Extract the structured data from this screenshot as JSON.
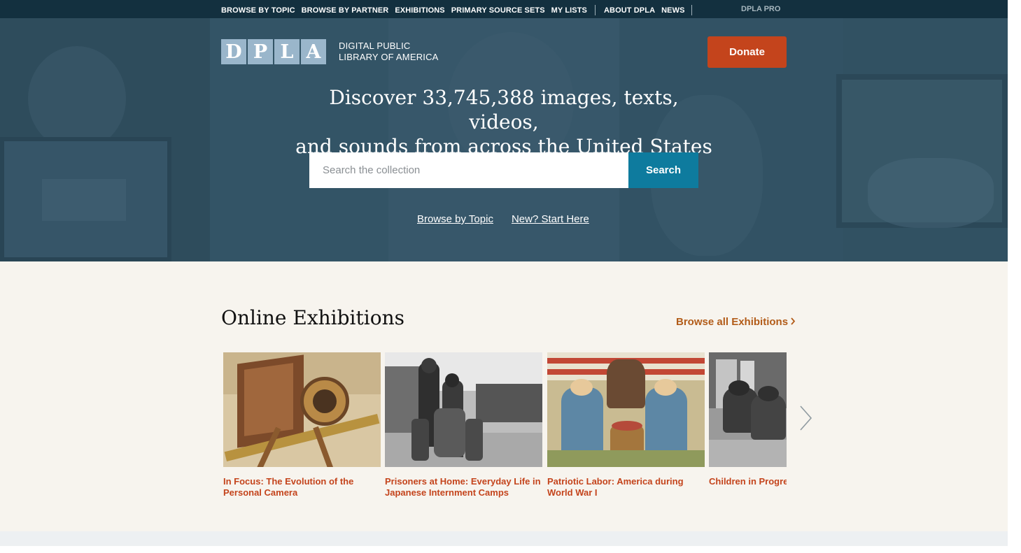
{
  "topnav": {
    "items": [
      "BROWSE BY TOPIC",
      "BROWSE BY PARTNER",
      "EXHIBITIONS",
      "PRIMARY SOURCE SETS",
      "MY LISTS"
    ],
    "about": "ABOUT DPLA",
    "news": "NEWS",
    "pro": "DPLA PRO"
  },
  "logo": {
    "letters": [
      "D",
      "P",
      "L",
      "A"
    ],
    "name": "DIGITAL PUBLIC LIBRARY OF AMERICA"
  },
  "donate_label": "Donate",
  "hero": {
    "headline_line1": "Discover 33,745,388 images, texts, videos,",
    "headline_line2": "and sounds from across the United States",
    "search_placeholder": "Search the collection",
    "search_button": "Search",
    "links": [
      "Browse by Topic",
      "New? Start Here"
    ]
  },
  "exhibitions": {
    "title": "Online Exhibitions",
    "browse_all": "Browse all Exhibitions",
    "cards": [
      {
        "caption": "In Focus: The Evolution of the Personal Camera"
      },
      {
        "caption": "Prisoners at Home: Everyday Life in Japanese Internment Camps"
      },
      {
        "caption": "Patriotic Labor: America during World War I"
      },
      {
        "caption": "Children in Progressive-Era America"
      }
    ]
  },
  "colors": {
    "topnav_bg": "#13303f",
    "hero_bg": "#3a5b6c",
    "donate": "#c4441c",
    "search_button": "#0e7b9e",
    "accent_orange": "#b25c19",
    "section_bg": "#f7f4ee"
  },
  "icons": {
    "browse_all_chevron": "chevron-right-icon",
    "carousel_next": "chevron-right-icon"
  }
}
